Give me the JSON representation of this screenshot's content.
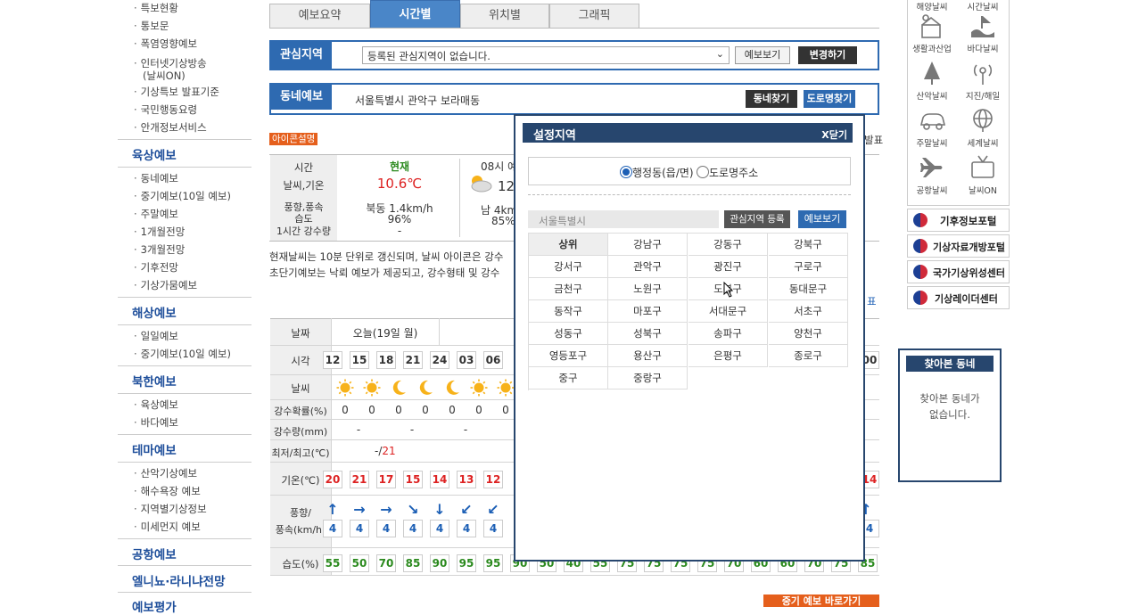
{
  "sidebar": {
    "top_items": [
      "특보현황",
      "통보문",
      "폭염영향예보",
      "인터넷기상방송",
      "(날씨ON)",
      "기상특보 발표기준",
      "국민행동요령",
      "안개정보서비스"
    ],
    "groups": [
      {
        "title": "육상예보",
        "items": [
          "동네예보",
          "중기예보(10일 예보)",
          "주말예보",
          "1개월전망",
          "3개월전망",
          "기후전망",
          "기상가뭄예보"
        ]
      },
      {
        "title": "해상예보",
        "items": [
          "일일예보",
          "중기예보(10일 예보)"
        ]
      },
      {
        "title": "북한예보",
        "items": [
          "육상예보",
          "바다예보"
        ]
      },
      {
        "title": "테마예보",
        "items": [
          "산악기상예보",
          "해수욕장 예보",
          "지역별기상정보",
          "미세먼지 예보"
        ]
      },
      {
        "title": "공항예보",
        "items": []
      },
      {
        "title": "엘니뇨·라니냐전망",
        "items": []
      },
      {
        "title": "예보평가",
        "items": []
      }
    ]
  },
  "tabs": [
    "예보요약",
    "시간별",
    "위치별",
    "그래픽"
  ],
  "interest": {
    "label": "관심지역",
    "select_value": "등록된 관심지역이 없습니다.",
    "view_btn": "예보보기",
    "change_btn": "변경하기"
  },
  "local": {
    "label": "동네예보",
    "address": "서울특별시 관악구 보라매동",
    "find_btn": "동네찾기",
    "road_btn": "도로명찾기"
  },
  "icon_note": "아이콘설명",
  "right_cut": "발표",
  "right_cut2": "표",
  "current": {
    "labels": [
      "시간",
      "날씨,기온",
      "풍향,풍속",
      "습도",
      "1시간 강수량"
    ],
    "now_title": "현재",
    "now_temp": "10.6℃",
    "now_wind": "북동 1.4km/h",
    "now_humid": "96%",
    "now_rain": "-",
    "next_time": "08시 예",
    "next_temp": "12",
    "next_wind": "남 4km",
    "next_humid": "85%"
  },
  "notice1": "현재날씨는 10분 단위로 갱신되며, 날씨 아이콘은 강수",
  "notice2": "초단기예보는 낙뢰 예보가 제공되고, 강수형태 및 강수",
  "table": {
    "row_labels": [
      "날짜",
      "시각",
      "날씨",
      "강수확률(%)",
      "강수량(mm)",
      "최저/최고(℃)",
      "기온(℃)",
      "풍향/",
      "풍속(km/h)",
      "습도(%)"
    ],
    "date": "오늘(19일 월)",
    "hours": [
      "12",
      "15",
      "18",
      "21",
      "24",
      "03",
      "06"
    ],
    "hour_last": "00",
    "weather": [
      "sun",
      "sun",
      "moon",
      "moon",
      "moon",
      "sun",
      "sun"
    ],
    "pop": [
      "0",
      "0",
      "0",
      "0",
      "0",
      "0",
      "0"
    ],
    "rain": [
      "-",
      "-",
      "-"
    ],
    "minmax_min": "-/",
    "minmax_max": "21",
    "temps": [
      "20",
      "21",
      "17",
      "15",
      "14",
      "13",
      "12"
    ],
    "temp_last": "14",
    "wind_dir": [
      "↑",
      "→",
      "→",
      "↘",
      "↓",
      "↙",
      "↙"
    ],
    "wind_speed": [
      "4",
      "4",
      "4",
      "4",
      "4",
      "4",
      "4"
    ],
    "wind_last": "4",
    "humid": [
      "55",
      "50",
      "70",
      "85",
      "90",
      "95",
      "95",
      "90",
      "50",
      "40",
      "55",
      "75",
      "75",
      "75",
      "75",
      "70",
      "60",
      "60",
      "70",
      "75",
      "85"
    ]
  },
  "popup": {
    "title": "설정지역",
    "close": "X닫기",
    "radio1": "행정동(읍/면)",
    "radio2": "도로명주소",
    "region": "서울특별시",
    "register_btn": "관심지역 등록",
    "view_btn": "예보보기",
    "districts": [
      "상위",
      "강남구",
      "강동구",
      "강북구",
      "강서구",
      "관악구",
      "광진구",
      "구로구",
      "금천구",
      "노원구",
      "도봉구",
      "동대문구",
      "동작구",
      "마포구",
      "서대문구",
      "서초구",
      "성동구",
      "성북구",
      "송파구",
      "양천구",
      "영등포구",
      "용산구",
      "은평구",
      "종로구",
      "중구",
      "중랑구"
    ]
  },
  "right": {
    "top_cut": [
      "해양날씨",
      "시간날씨"
    ],
    "icons": [
      "생활과산업",
      "바다날씨",
      "산악날씨",
      "지진/해일",
      "주말날씨",
      "세계날씨",
      "공항날씨",
      "날씨ON"
    ],
    "links": [
      "기후정보포털",
      "기상자료개방포털",
      "국가기상위성센터",
      "기상레이더센터"
    ],
    "visited_title": "찾아본 동네",
    "visited_msg1": "찾아본 동네가",
    "visited_msg2": "없습니다."
  },
  "bottom_btn": "중기 예보 바로가기"
}
